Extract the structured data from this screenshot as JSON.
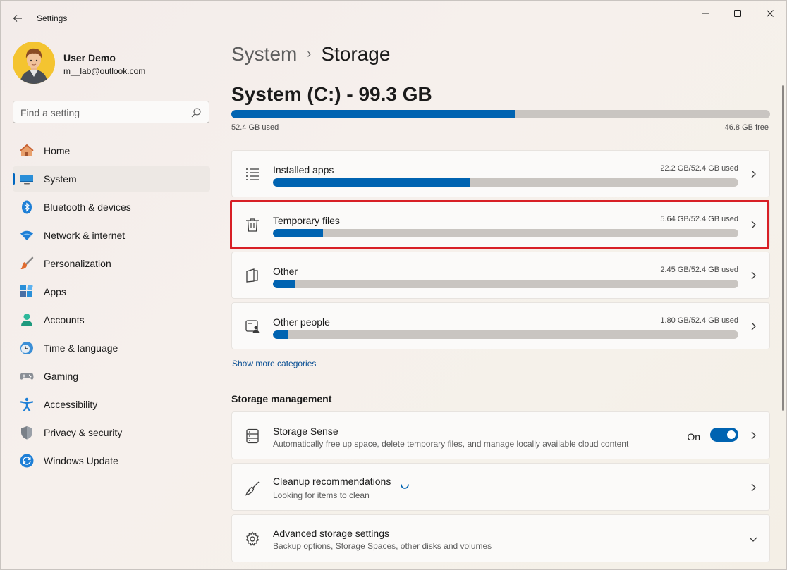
{
  "window": {
    "app_title": "Settings",
    "back_icon": "back-arrow-icon",
    "controls": [
      "minimize-icon",
      "maximize-icon",
      "close-icon"
    ]
  },
  "profile": {
    "name": "User Demo",
    "email": "m__lab@outlook.com"
  },
  "search": {
    "placeholder": "Find a setting",
    "value": ""
  },
  "sidebar": {
    "items": [
      {
        "label": "Home",
        "icon": "home-icon",
        "active": false
      },
      {
        "label": "System",
        "icon": "system-icon",
        "active": true
      },
      {
        "label": "Bluetooth & devices",
        "icon": "bluetooth-icon",
        "active": false
      },
      {
        "label": "Network & internet",
        "icon": "wifi-icon",
        "active": false
      },
      {
        "label": "Personalization",
        "icon": "brush-icon",
        "active": false
      },
      {
        "label": "Apps",
        "icon": "apps-icon",
        "active": false
      },
      {
        "label": "Accounts",
        "icon": "accounts-icon",
        "active": false
      },
      {
        "label": "Time & language",
        "icon": "clock-globe-icon",
        "active": false
      },
      {
        "label": "Gaming",
        "icon": "gamepad-icon",
        "active": false
      },
      {
        "label": "Accessibility",
        "icon": "accessibility-icon",
        "active": false
      },
      {
        "label": "Privacy & security",
        "icon": "shield-icon",
        "active": false
      },
      {
        "label": "Windows Update",
        "icon": "update-icon",
        "active": false
      }
    ]
  },
  "breadcrumb": {
    "parent": "System",
    "separator": "›",
    "current": "Storage"
  },
  "drive": {
    "title": "System (C:) - 99.3 GB",
    "used_label": "52.4 GB used",
    "free_label": "46.8 GB free",
    "used_fraction": 0.528
  },
  "categories": [
    {
      "label": "Installed apps",
      "usage": "22.2 GB/52.4 GB used",
      "fraction": 0.424,
      "icon": "list-icon"
    },
    {
      "label": "Temporary files",
      "usage": "5.64 GB/52.4 GB used",
      "fraction": 0.108,
      "icon": "trash-icon"
    },
    {
      "label": "Other",
      "usage": "2.45 GB/52.4 GB used",
      "fraction": 0.047,
      "icon": "folder-icon"
    },
    {
      "label": "Other people",
      "usage": "1.80 GB/52.4 GB used",
      "fraction": 0.034,
      "icon": "people-icon"
    }
  ],
  "show_more": "Show more categories",
  "storage_management": {
    "heading": "Storage management",
    "storage_sense": {
      "title": "Storage Sense",
      "description": "Automatically free up space, delete temporary files, and manage locally available cloud content",
      "toggle_label": "On",
      "toggle_on": true
    },
    "cleanup": {
      "title": "Cleanup recommendations",
      "description": "Looking for items to clean"
    },
    "advanced": {
      "title": "Advanced storage settings",
      "description": "Backup options, Storage Spaces, other disks and volumes"
    }
  },
  "colors": {
    "accent": "#0063b1",
    "highlight": "#d81f26",
    "bar_track": "#c9c5c1"
  }
}
